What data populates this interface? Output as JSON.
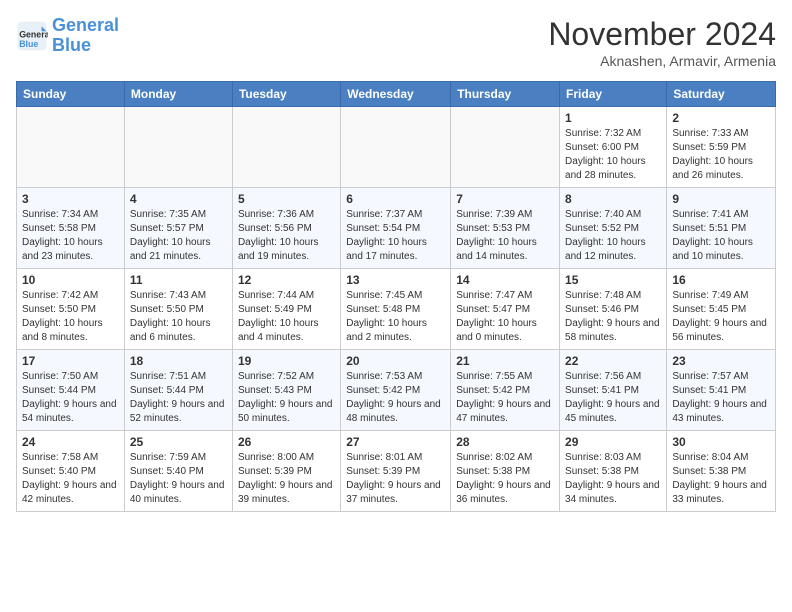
{
  "logo": {
    "line1": "General",
    "line2": "Blue"
  },
  "title": "November 2024",
  "location": "Aknashen, Armavir, Armenia",
  "days_of_week": [
    "Sunday",
    "Monday",
    "Tuesday",
    "Wednesday",
    "Thursday",
    "Friday",
    "Saturday"
  ],
  "weeks": [
    [
      {
        "day": "",
        "info": ""
      },
      {
        "day": "",
        "info": ""
      },
      {
        "day": "",
        "info": ""
      },
      {
        "day": "",
        "info": ""
      },
      {
        "day": "",
        "info": ""
      },
      {
        "day": "1",
        "info": "Sunrise: 7:32 AM\nSunset: 6:00 PM\nDaylight: 10 hours and 28 minutes."
      },
      {
        "day": "2",
        "info": "Sunrise: 7:33 AM\nSunset: 5:59 PM\nDaylight: 10 hours and 26 minutes."
      }
    ],
    [
      {
        "day": "3",
        "info": "Sunrise: 7:34 AM\nSunset: 5:58 PM\nDaylight: 10 hours and 23 minutes."
      },
      {
        "day": "4",
        "info": "Sunrise: 7:35 AM\nSunset: 5:57 PM\nDaylight: 10 hours and 21 minutes."
      },
      {
        "day": "5",
        "info": "Sunrise: 7:36 AM\nSunset: 5:56 PM\nDaylight: 10 hours and 19 minutes."
      },
      {
        "day": "6",
        "info": "Sunrise: 7:37 AM\nSunset: 5:54 PM\nDaylight: 10 hours and 17 minutes."
      },
      {
        "day": "7",
        "info": "Sunrise: 7:39 AM\nSunset: 5:53 PM\nDaylight: 10 hours and 14 minutes."
      },
      {
        "day": "8",
        "info": "Sunrise: 7:40 AM\nSunset: 5:52 PM\nDaylight: 10 hours and 12 minutes."
      },
      {
        "day": "9",
        "info": "Sunrise: 7:41 AM\nSunset: 5:51 PM\nDaylight: 10 hours and 10 minutes."
      }
    ],
    [
      {
        "day": "10",
        "info": "Sunrise: 7:42 AM\nSunset: 5:50 PM\nDaylight: 10 hours and 8 minutes."
      },
      {
        "day": "11",
        "info": "Sunrise: 7:43 AM\nSunset: 5:50 PM\nDaylight: 10 hours and 6 minutes."
      },
      {
        "day": "12",
        "info": "Sunrise: 7:44 AM\nSunset: 5:49 PM\nDaylight: 10 hours and 4 minutes."
      },
      {
        "day": "13",
        "info": "Sunrise: 7:45 AM\nSunset: 5:48 PM\nDaylight: 10 hours and 2 minutes."
      },
      {
        "day": "14",
        "info": "Sunrise: 7:47 AM\nSunset: 5:47 PM\nDaylight: 10 hours and 0 minutes."
      },
      {
        "day": "15",
        "info": "Sunrise: 7:48 AM\nSunset: 5:46 PM\nDaylight: 9 hours and 58 minutes."
      },
      {
        "day": "16",
        "info": "Sunrise: 7:49 AM\nSunset: 5:45 PM\nDaylight: 9 hours and 56 minutes."
      }
    ],
    [
      {
        "day": "17",
        "info": "Sunrise: 7:50 AM\nSunset: 5:44 PM\nDaylight: 9 hours and 54 minutes."
      },
      {
        "day": "18",
        "info": "Sunrise: 7:51 AM\nSunset: 5:44 PM\nDaylight: 9 hours and 52 minutes."
      },
      {
        "day": "19",
        "info": "Sunrise: 7:52 AM\nSunset: 5:43 PM\nDaylight: 9 hours and 50 minutes."
      },
      {
        "day": "20",
        "info": "Sunrise: 7:53 AM\nSunset: 5:42 PM\nDaylight: 9 hours and 48 minutes."
      },
      {
        "day": "21",
        "info": "Sunrise: 7:55 AM\nSunset: 5:42 PM\nDaylight: 9 hours and 47 minutes."
      },
      {
        "day": "22",
        "info": "Sunrise: 7:56 AM\nSunset: 5:41 PM\nDaylight: 9 hours and 45 minutes."
      },
      {
        "day": "23",
        "info": "Sunrise: 7:57 AM\nSunset: 5:41 PM\nDaylight: 9 hours and 43 minutes."
      }
    ],
    [
      {
        "day": "24",
        "info": "Sunrise: 7:58 AM\nSunset: 5:40 PM\nDaylight: 9 hours and 42 minutes."
      },
      {
        "day": "25",
        "info": "Sunrise: 7:59 AM\nSunset: 5:40 PM\nDaylight: 9 hours and 40 minutes."
      },
      {
        "day": "26",
        "info": "Sunrise: 8:00 AM\nSunset: 5:39 PM\nDaylight: 9 hours and 39 minutes."
      },
      {
        "day": "27",
        "info": "Sunrise: 8:01 AM\nSunset: 5:39 PM\nDaylight: 9 hours and 37 minutes."
      },
      {
        "day": "28",
        "info": "Sunrise: 8:02 AM\nSunset: 5:38 PM\nDaylight: 9 hours and 36 minutes."
      },
      {
        "day": "29",
        "info": "Sunrise: 8:03 AM\nSunset: 5:38 PM\nDaylight: 9 hours and 34 minutes."
      },
      {
        "day": "30",
        "info": "Sunrise: 8:04 AM\nSunset: 5:38 PM\nDaylight: 9 hours and 33 minutes."
      }
    ]
  ]
}
